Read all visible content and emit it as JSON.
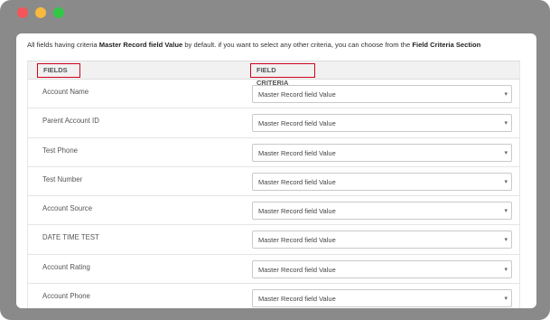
{
  "window": {
    "controls": [
      "close",
      "minimize",
      "maximize"
    ],
    "colors": {
      "close": "#f2565a",
      "minimize": "#f7b93e",
      "maximize": "#33c748"
    }
  },
  "info": {
    "part1": "All fields having criteria ",
    "bold1": "Master Record field Value",
    "part2": " by default. if you want to select any other criteria, you can choose from the ",
    "bold2": "Field Criteria Section"
  },
  "table": {
    "headers": {
      "fields": "FIELDS",
      "criteria": "FIELD CRITERIA"
    },
    "header_highlight_color": "#d0021b",
    "rows": [
      {
        "field": "Account Name",
        "criteria": "Master Record field Value"
      },
      {
        "field": "Parent Account ID",
        "criteria": "Master Record field Value"
      },
      {
        "field": "Test Phone",
        "criteria": "Master Record field Value"
      },
      {
        "field": "Test Number",
        "criteria": "Master Record field Value"
      },
      {
        "field": "Account Source",
        "criteria": "Master Record field Value"
      },
      {
        "field": "DATE TIME TEST",
        "criteria": "Master Record field Value"
      },
      {
        "field": "Account Rating",
        "criteria": "Master Record field Value"
      },
      {
        "field": "Account Phone",
        "criteria": "Master Record field Value"
      }
    ]
  }
}
